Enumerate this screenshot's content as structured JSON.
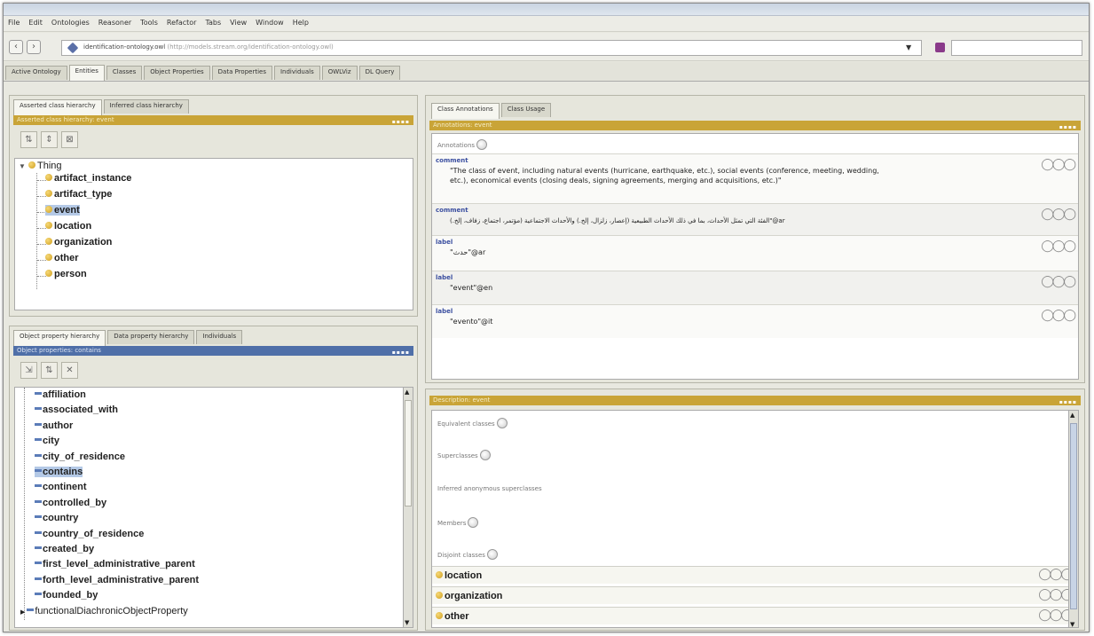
{
  "menu": [
    "File",
    "Edit",
    "Ontologies",
    "Reasoner",
    "Tools",
    "Refactor",
    "Tabs",
    "View",
    "Window",
    "Help"
  ],
  "address": {
    "ontology_name": "identification-ontology.owl",
    "ontology_uri": "(http://models.stream.org/identification-ontology.owl)"
  },
  "main_tabs": [
    "Active Ontology",
    "Entities",
    "Classes",
    "Object Properties",
    "Data Properties",
    "Individuals",
    "OWLViz",
    "DL Query"
  ],
  "selected_main_tab": "Entities",
  "class_pane": {
    "tabs": [
      "Asserted class hierarchy",
      "Inferred class hierarchy"
    ],
    "header": "Asserted class hierarchy: event",
    "root": "Thing",
    "items": [
      "artifact_instance",
      "artifact_type",
      "event",
      "location",
      "organization",
      "other",
      "person"
    ],
    "selected": "event"
  },
  "property_pane": {
    "tabs": [
      "Object property hierarchy",
      "Data property hierarchy",
      "Individuals"
    ],
    "header": "Object properties: contains",
    "items": [
      "affiliation",
      "associated_with",
      "author",
      "city",
      "city_of_residence",
      "contains",
      "continent",
      "controlled_by",
      "country",
      "country_of_residence",
      "created_by",
      "first_level_administrative_parent",
      "forth_level_administrative_parent",
      "founded_by",
      "functionalDiachronicObjectProperty"
    ],
    "selected": "contains"
  },
  "annotation_pane": {
    "tabs": [
      "Class Annotations",
      "Class Usage"
    ],
    "header": "Annotations: event",
    "annotations_label": "Annotations",
    "rows": [
      {
        "key": "comment",
        "lines": [
          "\"The class of event, including natural events (hurricane, earthquake, etc.), social events (conference, meeting, wedding,",
          "etc.), economical events (closing deals, signing agreements, merging and acquisitions, etc.)\""
        ]
      },
      {
        "key": "comment",
        "lines": [
          "الفئة التي تمثل الأحداث، بما في ذلك الأحداث الطبيعية (إعصار، زلزال، إلخ.) والأحداث الاجتماعية (مؤتمر، اجتماع، زفاف، إلخ.)\"@ar"
        ]
      },
      {
        "key": "label",
        "lines": [
          "\"حدث\"@ar"
        ]
      },
      {
        "key": "label",
        "lines": [
          "\"event\"@en"
        ]
      },
      {
        "key": "label",
        "lines": [
          "\"evento\"@it"
        ]
      }
    ]
  },
  "description_pane": {
    "header": "Description: event",
    "sections": [
      "Equivalent classes",
      "Superclasses",
      "Inferred anonymous superclasses",
      "Members",
      "Disjoint classes"
    ],
    "disjoint": [
      "location",
      "organization",
      "other"
    ]
  }
}
